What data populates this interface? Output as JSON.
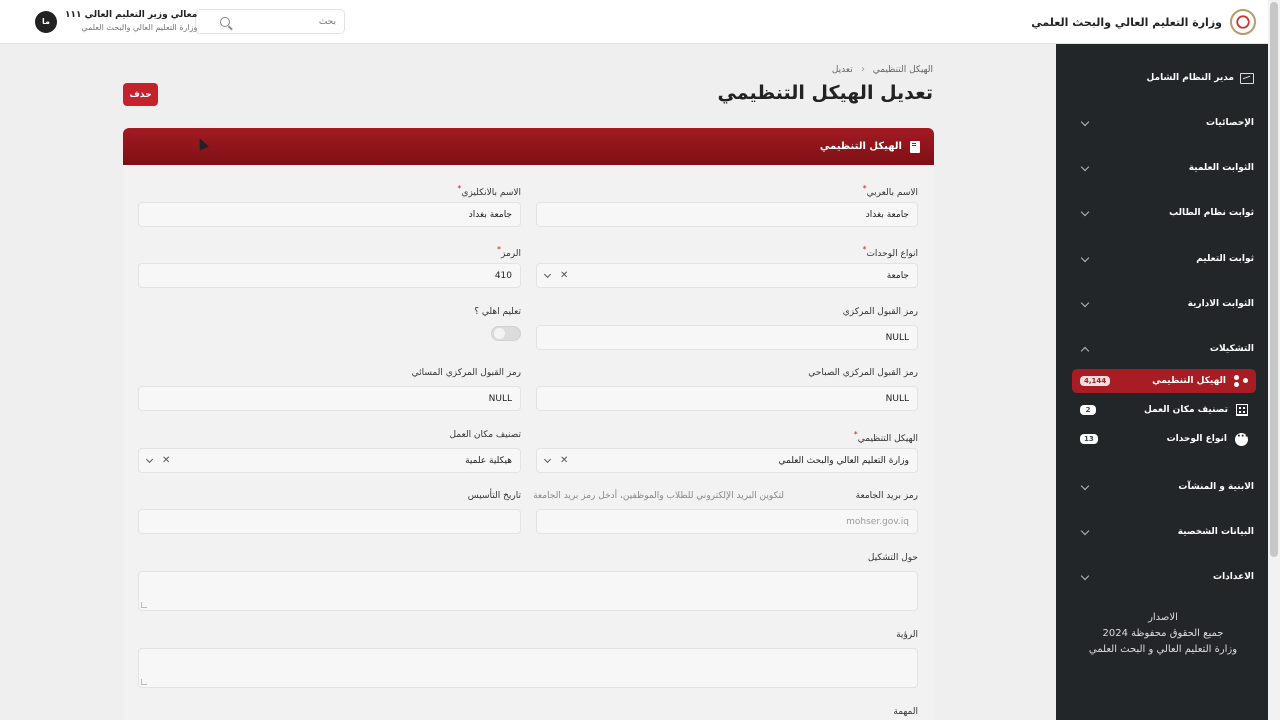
{
  "header": {
    "brand_title": "وزارة التعليم العالي والبحث العلمي",
    "search_placeholder": "بحث",
    "user_name": "معالي وزير التعليم العالي ١١١",
    "user_org": "وزارة التعليم العالي والبحث العلمي",
    "user_initials": "ما"
  },
  "sidebar": {
    "items": [
      {
        "label": "مدير النظام الشامل",
        "icon": "dashboard-icon"
      },
      {
        "label": "الإحصائيات",
        "icon": "chevron-down-icon"
      },
      {
        "label": "الثوابت العلمية",
        "icon": "chevron-down-icon"
      },
      {
        "label": "ثوابت نظام الطالب",
        "icon": "chevron-down-icon"
      },
      {
        "label": "ثوابت التعليم",
        "icon": "chevron-down-icon"
      },
      {
        "label": "الثوابت الادارية",
        "icon": "chevron-down-icon"
      },
      {
        "label": "التشكيلات",
        "icon": "chevron-up-icon"
      },
      {
        "label": "الابنية و المنشآت",
        "icon": "chevron-down-icon"
      },
      {
        "label": "البيانات الشخصية",
        "icon": "chevron-down-icon"
      },
      {
        "label": "الاعدادات",
        "icon": "chevron-down-icon"
      }
    ],
    "sub_items": [
      {
        "label": "الهيكل التنظيمي",
        "badge": "4,144",
        "icon": "share-nodes-icon"
      },
      {
        "label": "تصنيف مكان العمل",
        "badge": "2",
        "icon": "building-icon"
      },
      {
        "label": "انواع الوحدات",
        "badge": "13",
        "icon": "dots-circle-icon"
      }
    ],
    "footer": {
      "line1": "الاصدار",
      "line2": "جميع الحقوق محفوظة 2024",
      "line3": "وزارة التعليم العالي و البحث العلمي"
    }
  },
  "main": {
    "breadcrumb": [
      "الهيكل التنظيمي",
      "تعديل"
    ],
    "title": "تعديل الهيكل التنظيمي",
    "delete_label": "حذف",
    "card_title": "الهيكل التنظيمي",
    "form": {
      "name_ar_label": "الاسم بالعربي",
      "name_ar_value": "جامعة بغداد",
      "name_en_label": "الاسم بالانكليزي",
      "name_en_value": "جامعة بغداد",
      "unit_type_label": "انواع الوحدات",
      "unit_type_value": "جامعة",
      "code_label": "الرمز",
      "code_value": "410",
      "central_code_label": "رمز القبول المركزي",
      "central_code_value": "NULL",
      "private_label": "تعليم اهلي ؟",
      "morning_code_label": "رمز القبول المركزي الصباحي",
      "morning_code_value": "NULL",
      "evening_code_label": "رمز القبول المركزي المسائي",
      "evening_code_value": "NULL",
      "org_label": "الهيكل التنظيمي",
      "org_value": "وزارة التعليم العالي والبحث العلمي",
      "workplace_label": "تصنيف مكان العمل",
      "workplace_value": "هيكلية علمية",
      "email_label": "رمز بريد الجامعة",
      "email_hint": "لتكوين البريد الإلكتروني للطلاب والموظفين، أدخل رمز بريد الجامعة",
      "email_placeholder": "mohser.gov.iq",
      "founded_label": "تاريخ التأسيس",
      "founded_value": "",
      "about_label": "حول التشكيل",
      "vision_label": "الرؤية",
      "mission_label": "المهمة"
    }
  }
}
